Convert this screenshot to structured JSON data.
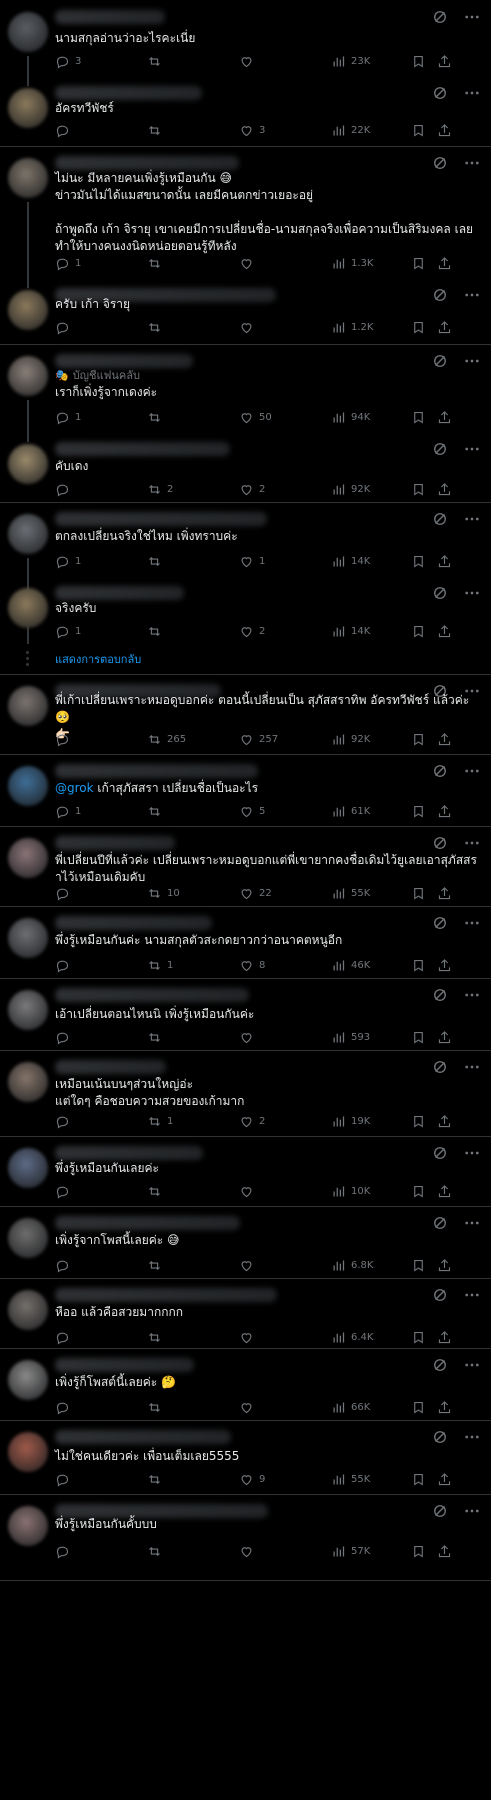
{
  "show_replies_label": "แสดงการตอบกลับ",
  "grok_mention": "@grok",
  "tweets": [
    {
      "avatar": "#5a5e63",
      "text": "นามสกุลอ่านว่าอะไรคะเนี่ย",
      "counts": {
        "reply": "3",
        "retweet": "",
        "like": "",
        "views": "23K"
      }
    },
    {
      "avatar": "#8b7a5c",
      "text": "อัครทวีพัชร์",
      "counts": {
        "reply": "",
        "retweet": "",
        "like": "3",
        "views": "22K"
      }
    },
    {
      "avatar": "#7e7569",
      "text": "ไม่นะ มีหลายคนเพิ่งรู้เหมือนกัน 😅\nข่าวมันไม่ได้แมสขนาดนั้น เลยมีคนตกข่าวเยอะอยู่\n\nถ้าพูดถึง เก้า จิรายุ เขาเคยมีการเปลี่ยนชื่อ-นามสกุลจริงเพื่อความเป็นสิริมงคล เลยทำให้บางคนงงนิดหน่อยตอนรู้ทีหลัง",
      "counts": {
        "reply": "1",
        "retweet": "",
        "like": "",
        "views": "1.3K"
      }
    },
    {
      "avatar": "#8b7a5c",
      "text": "ครับ เก้า จิรายุ",
      "counts": {
        "reply": "",
        "retweet": "",
        "like": "",
        "views": "1.2K"
      }
    },
    {
      "avatar": "#8a8078",
      "badge": "บัญชีแฟนคลับ",
      "text": "เราก็เพิ่งรู้จากเดงค่ะ",
      "counts": {
        "reply": "1",
        "retweet": "",
        "like": "50",
        "views": "94K"
      }
    },
    {
      "avatar": "#9a8a6a",
      "text": "คับเดง",
      "counts": {
        "reply": "",
        "retweet": "2",
        "like": "2",
        "views": "92K"
      }
    },
    {
      "avatar": "#6b6f74",
      "text": "ตกลงเปลี่ยนจริงใช่ไหม เพิ่งทราบค่ะ",
      "counts": {
        "reply": "1",
        "retweet": "",
        "like": "1",
        "views": "14K"
      }
    },
    {
      "avatar": "#8b7a5c",
      "text": "จริงครับ",
      "counts": {
        "reply": "1",
        "retweet": "",
        "like": "2",
        "views": "14K"
      }
    },
    {
      "avatar": "#7b7470",
      "text": "พี่เก้าเปลี่ยนเพราะหมอดูบอกค่ะ  ตอนนี้เปลี่ยนเป็น สุภัสสราทิพ อัครทวีพัชร์ แล้วค่ะ🥺\n👉🏻",
      "counts": {
        "reply": "",
        "retweet": "265",
        "like": "257",
        "views": "92K"
      }
    },
    {
      "avatar": "#3f6e96",
      "text": "เก้าสุภัสสรา เปลี่ยนชื่อเป็นอะไร",
      "mention": true,
      "counts": {
        "reply": "1",
        "retweet": "",
        "like": "5",
        "views": "61K"
      }
    },
    {
      "avatar": "#8a7478",
      "text": "พี่เปลี่ยนปีที่แล้วค่ะ เปลี่ยนเพราะหมอดูบอกแต่พี่เขายากคงชื่อเดิมไว้ยูเลยเอาสุภัสสราไว้เหมือนเดิมคับ",
      "counts": {
        "reply": "",
        "retweet": "10",
        "like": "22",
        "views": "55K"
      }
    },
    {
      "avatar": "#6d6f73",
      "text": "พึ่งรู้เหมือนกันค่ะ นามสกุลตัวสะกดยาวกว่าอนาคตหนูอีก",
      "counts": {
        "reply": "",
        "retweet": "1",
        "like": "8",
        "views": "46K"
      }
    },
    {
      "avatar": "#7a7a7c",
      "text": "เอ้าเปลี่ยนตอนไหนนิ เพิ่งรู้เหมือนกันค่ะ",
      "counts": {
        "reply": "",
        "retweet": "",
        "like": "",
        "views": "593"
      }
    },
    {
      "avatar": "#85756a",
      "text": "เหมือนเน้นบนๆส่วนใหญ่อ่ะ\nแต่ใดๆ คือชอบความสวยของเก้ามาก",
      "counts": {
        "reply": "",
        "retweet": "1",
        "like": "2",
        "views": "19K"
      }
    },
    {
      "avatar": "#5d6b86",
      "text": "พึ่งรู้เหมือนกันเลยค่ะ",
      "counts": {
        "reply": "",
        "retweet": "",
        "like": "",
        "views": "10K"
      }
    },
    {
      "avatar": "#6e6e6e",
      "text": "เพิ่งรู้จากโพสนี้เลยค่ะ 😅",
      "counts": {
        "reply": "",
        "retweet": "",
        "like": "",
        "views": "6.8K"
      }
    },
    {
      "avatar": "#75706c",
      "text": "หืออ แล้วคือสวยมากกกก",
      "counts": {
        "reply": "",
        "retweet": "",
        "like": "",
        "views": "6.4K"
      }
    },
    {
      "avatar": "#8a8a8a",
      "text": "เพิ่งรู้ก็โพสต์นี้เลยค่ะ 🤔",
      "counts": {
        "reply": "",
        "retweet": "",
        "like": "",
        "views": "66K"
      }
    },
    {
      "avatar": "#a05a4a",
      "text": "ไม่ใช่คนเดียวค่ะ เพื่อนเต็มเลย5555",
      "counts": {
        "reply": "",
        "retweet": "",
        "like": "9",
        "views": "55K"
      }
    },
    {
      "avatar": "#8a7272",
      "text": "พึ่งรู้เหมือนกันคั้บบบ",
      "counts": {
        "reply": "",
        "retweet": "",
        "like": "",
        "views": "57K"
      }
    }
  ]
}
